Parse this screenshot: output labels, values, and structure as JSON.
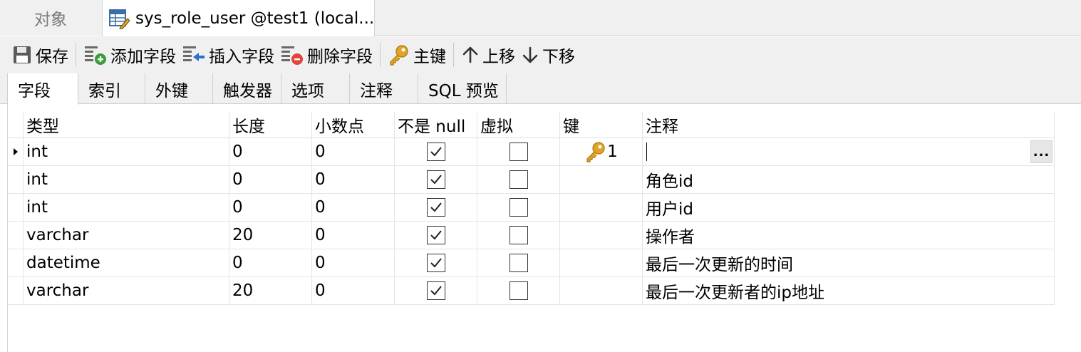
{
  "tabs": {
    "objects_label": "对象",
    "table_label": "sys_role_user @test1 (local..."
  },
  "toolbar": {
    "save": "保存",
    "add_field": "添加字段",
    "insert_field": "插入字段",
    "delete_field": "删除字段",
    "primary_key": "主键",
    "move_up": "上移",
    "move_down": "下移"
  },
  "sub_tabs": [
    "字段",
    "索引",
    "外键",
    "触发器",
    "选项",
    "注释",
    "SQL 预览"
  ],
  "grid": {
    "headers": [
      "类型",
      "长度",
      "小数点",
      "不是 null",
      "虚拟",
      "键",
      "注释"
    ],
    "rows": [
      {
        "type": "int",
        "length": "0",
        "decimals": "0",
        "not_null": true,
        "virtual": false,
        "key": "1",
        "comment": ""
      },
      {
        "type": "int",
        "length": "0",
        "decimals": "0",
        "not_null": true,
        "virtual": false,
        "key": "",
        "comment": "角色id"
      },
      {
        "type": "int",
        "length": "0",
        "decimals": "0",
        "not_null": true,
        "virtual": false,
        "key": "",
        "comment": "用户id"
      },
      {
        "type": "varchar",
        "length": "20",
        "decimals": "0",
        "not_null": true,
        "virtual": false,
        "key": "",
        "comment": "操作者"
      },
      {
        "type": "datetime",
        "length": "0",
        "decimals": "0",
        "not_null": true,
        "virtual": false,
        "key": "",
        "comment": "最后一次更新的时间"
      },
      {
        "type": "varchar",
        "length": "20",
        "decimals": "0",
        "not_null": true,
        "virtual": false,
        "key": "",
        "comment": "最后一次更新者的ip地址"
      }
    ],
    "ellipsis": "..."
  },
  "colors": {
    "key_gold": "#e0a526",
    "add_green": "#3a9d3a",
    "delete_red": "#e0453a",
    "insert_blue": "#2f6fd0"
  }
}
